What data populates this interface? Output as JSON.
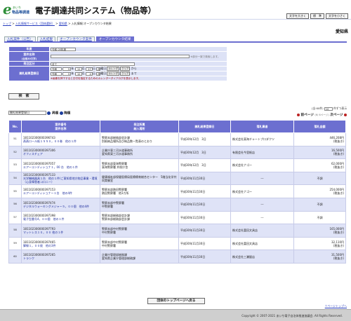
{
  "header": {
    "logo_sub": "あいち",
    "logo_name": "物品等調達",
    "title": "電子調達共同システム（物品等）",
    "buttons": [
      "文字を大きく",
      "標　準",
      "文字を小さく"
    ]
  },
  "breadcrumb": {
    "items": [
      "トップ",
      "入札情報サービス（団体選択）",
      "愛知県",
      "入札情報:オープンカウンタ結果"
    ],
    "seps": [
      " > ",
      " > ",
      " > "
    ]
  },
  "prefecture": "愛知県",
  "tabs": [
    "入札案件（公告）",
    "入札結果",
    "オープンカウンタ案件",
    "オープンカウンタ結果"
  ],
  "form": {
    "year_label": "年度",
    "year_value": "令和 05年度",
    "case_label": "案件名称",
    "case_label_sub": "(全角30文字)",
    "case_note": "※部分一致で検索します。",
    "method_label": "発注区分",
    "method_value": "全て",
    "date_label": "開札結果登録日",
    "row1": {
      "era": "令和",
      "y": "5",
      "m": "11",
      "d": "27",
      "cal": "カレンダ",
      "clear": "クリア",
      "suffix": "から"
    },
    "row2": {
      "era": "令和",
      "y": "5",
      "m": "12",
      "d": "4",
      "cal": "カレンダ",
      "clear": "クリア",
      "suffix": "まで"
    },
    "units": [
      "年",
      "月",
      "日"
    ],
    "weekday1": "月",
    "weekday2": "月",
    "weekday_suffix": "曜日",
    "date_note": "※画像を押下すると日付を指定するためのカレンダーダイアログを表示します。",
    "search_btn": "検　索"
  },
  "sort": {
    "select": "開札結果登録日",
    "asc": "昇順",
    "desc": "降順"
  },
  "paging": {
    "total": "(全:60件)",
    "per_page": "10",
    "per_page_suffix": "件ずつ表示",
    "next": "次ページ",
    "prev": "前ページ",
    "page": "(6/ 6ページ)"
  },
  "table": {
    "headers": [
      "No.",
      "案件番号\n案件名称",
      "発注所属\n納入場所",
      "開札結果登録日",
      "落札業者",
      "落札金額"
    ],
    "rows": [
      {
        "no": "51",
        "id": "181102300000396743",
        "name": "燕燕ロール紙１５５０，００巻　他の１件",
        "dept": "警察本部総務部会計課",
        "place": "別紙納品場所及び納品数一覧表のとおり",
        "date": "平成30年12月　3日",
        "winner": "株式会社東海チャートプロダクツ",
        "amount": "446,208円",
        "tax": "(税抜き)"
      },
      {
        "no": "52",
        "id": "181102300000397306",
        "name": "オフィスチェア",
        "dept": "企業庁東三河水道事務所",
        "place": "愛知県東三河水道事務所",
        "date": "平成30年12月　3日",
        "winner": "有限会社今里紙店",
        "amount": "16,500円",
        "tax": "(税抜き)"
      },
      {
        "no": "53",
        "id": "181102300000397057",
        "name": "エアーコンディショナ１，00 台　他の１件",
        "dept": "警察本部東海警察署",
        "place": "東海警察署 井前庁舎",
        "date": "平成30年12月　3日",
        "winner": "株式会社ナゴー",
        "amount": "62,000円",
        "tax": "(税抜き)"
      },
      {
        "no": "54",
        "id": "181102300000397133",
        "name": "光学機械器具１台　他の１件(ご東知県地方物品事業・環境（心身障害者コロニー）",
        "dept": "健康福祉部保健医療局医療療育総合センター　5階当化学共同実験室",
        "place": "",
        "date": "平成30年11月30日",
        "winner": "---",
        "amount": "不調",
        "tax": ""
      },
      {
        "no": "55",
        "id": "181102300000397153",
        "name": "エアーコンディショナー１台　他の4件",
        "dept": "警察本部熱田警察署",
        "place": "熱田警察署　他3カ所",
        "date": "平成30年11月30日",
        "winner": "株式会社ナゴー",
        "amount": "254,000円",
        "tax": "(税抜き)"
      },
      {
        "no": "56",
        "id": "181102300000397474",
        "name": "デジタルウォーキングメジャー５，００個　他の4件",
        "dept": "警察本部中警察署",
        "place": "中警察署",
        "date": "平成30年11月30日",
        "winner": "---",
        "amount": "不調",
        "tax": ""
      },
      {
        "no": "57",
        "id": "181102300000397398",
        "name": "電子型番号4，００個　他の１件",
        "dept": "警察本部総務部会計課",
        "place": "警察本部総務部会計課",
        "date": "平成30年11月30日",
        "winner": "---",
        "amount": "不調",
        "tax": ""
      },
      {
        "no": "58",
        "id": "181102300000397793",
        "name": "マットレス１０，００ 他の１件",
        "dept": "警察本部中村警察署",
        "place": "中村警察署",
        "date": "平成30年11月30日",
        "winner": "株式会社富田文具店",
        "amount": "165,000円",
        "tax": "(税抜き)"
      },
      {
        "no": "59",
        "id": "181102300000397465",
        "name": "脚線１，００枚　他の3件",
        "dept": "警察本部中村警察署",
        "place": "中村警察署",
        "date": "平成30年11月30日",
        "winner": "株式会社富田文具店",
        "amount": "32,110円",
        "tax": "(税抜き)"
      },
      {
        "no": "60",
        "id": "181102300000397265",
        "name": "トランク",
        "dept": "企業庁管理部総務課",
        "place": "愛知県企業庁管理部総務課",
        "date": "平成30年11月30日",
        "winner": "株式会社三瀬屋店",
        "amount": "31,500円",
        "tax": "(税抜き)"
      }
    ]
  },
  "top_button": "団体のトップページへ戻る",
  "page_top": "↑ページトップへ",
  "copyright": "Copyright © 2007-2021 あいち電子自治体推進協議会. All Rights Reserved."
}
